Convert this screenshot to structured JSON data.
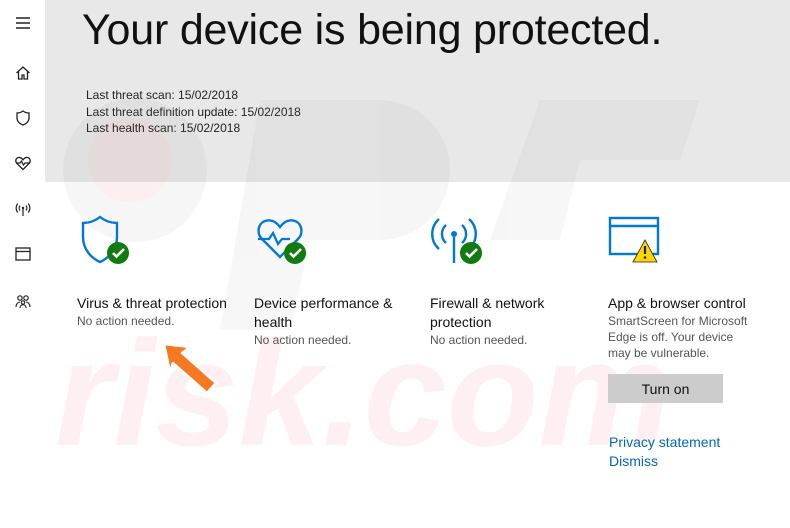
{
  "nav": {
    "items": [
      {
        "icon": "hamburger-menu-icon"
      },
      {
        "icon": "home-icon"
      },
      {
        "icon": "shield-icon"
      },
      {
        "icon": "heart-pulse-icon"
      },
      {
        "icon": "wireless-antenna-icon"
      },
      {
        "icon": "browser-window-icon"
      },
      {
        "icon": "family-icon"
      }
    ]
  },
  "header": {
    "title": "Your device is being protected.",
    "scan_lines": [
      "Last threat scan: 15/02/2018",
      "Last threat definition update: 15/02/2018",
      "Last health scan: 15/02/2018"
    ]
  },
  "tiles": [
    {
      "title": "Virus & threat protection",
      "status": "No action needed.",
      "icon": "shield-check-icon"
    },
    {
      "title": "Device performance & health",
      "status": "No action needed.",
      "icon": "heart-check-icon"
    },
    {
      "title": "Firewall & network protection",
      "status": "No action needed.",
      "icon": "antenna-check-icon"
    },
    {
      "title": "App & browser control",
      "status": "SmartScreen for Microsoft Edge is off.  Your device may be vulnerable.",
      "icon": "browser-warning-icon"
    }
  ],
  "actions": {
    "turn_on": "Turn on",
    "privacy": "Privacy statement",
    "dismiss": "Dismiss"
  },
  "colors": {
    "accent_blue": "#0078d7",
    "ok_green": "#107c10",
    "warning_yellow": "#ffd700",
    "header_bg": "#e8e8e8",
    "arrow_orange": "#f47920"
  }
}
